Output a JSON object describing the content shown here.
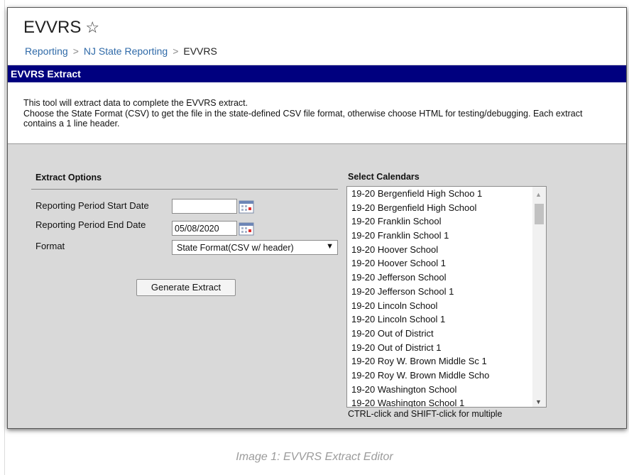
{
  "page": {
    "title": "EVVRS",
    "star_icon": "star-outline-icon"
  },
  "breadcrumb": {
    "items": [
      "Reporting",
      "NJ State Reporting",
      "EVVRS"
    ],
    "separator": ">"
  },
  "section_bar": {
    "title": "EVVRS Extract",
    "color": "#00007f"
  },
  "description": {
    "line1": "This tool will extract data to complete the EVVRS extract.",
    "line2": "Choose the State Format (CSV) to get the file in the state-defined CSV file format, otherwise choose HTML for testing/debugging. Each extract contains a 1 line header."
  },
  "extract_options": {
    "title": "Extract Options",
    "start_date": {
      "label": "Reporting Period Start Date",
      "value": ""
    },
    "end_date": {
      "label": "Reporting Period End Date",
      "value": "05/08/2020"
    },
    "format": {
      "label": "Format",
      "selected": "State Format(CSV w/ header)"
    },
    "generate_button": "Generate Extract"
  },
  "calendars": {
    "title": "Select Calendars",
    "items": [
      "19-20 Bergenfield High Schoo 1",
      "19-20 Bergenfield High School",
      "19-20 Franklin School",
      "19-20 Franklin School 1",
      "19-20 Hoover School",
      "19-20 Hoover School 1",
      "19-20 Jefferson School",
      "19-20 Jefferson School 1",
      "19-20 Lincoln School",
      "19-20 Lincoln School 1",
      "19-20 Out of District",
      "19-20 Out of District 1",
      "19-20 Roy W. Brown Middle Sc 1",
      "19-20 Roy W. Brown Middle Scho",
      "19-20 Washington School",
      "19-20 Washington School 1"
    ],
    "hint": "CTRL-click and SHIFT-click for multiple"
  },
  "caption": "Image 1: EVVRS Extract Editor"
}
